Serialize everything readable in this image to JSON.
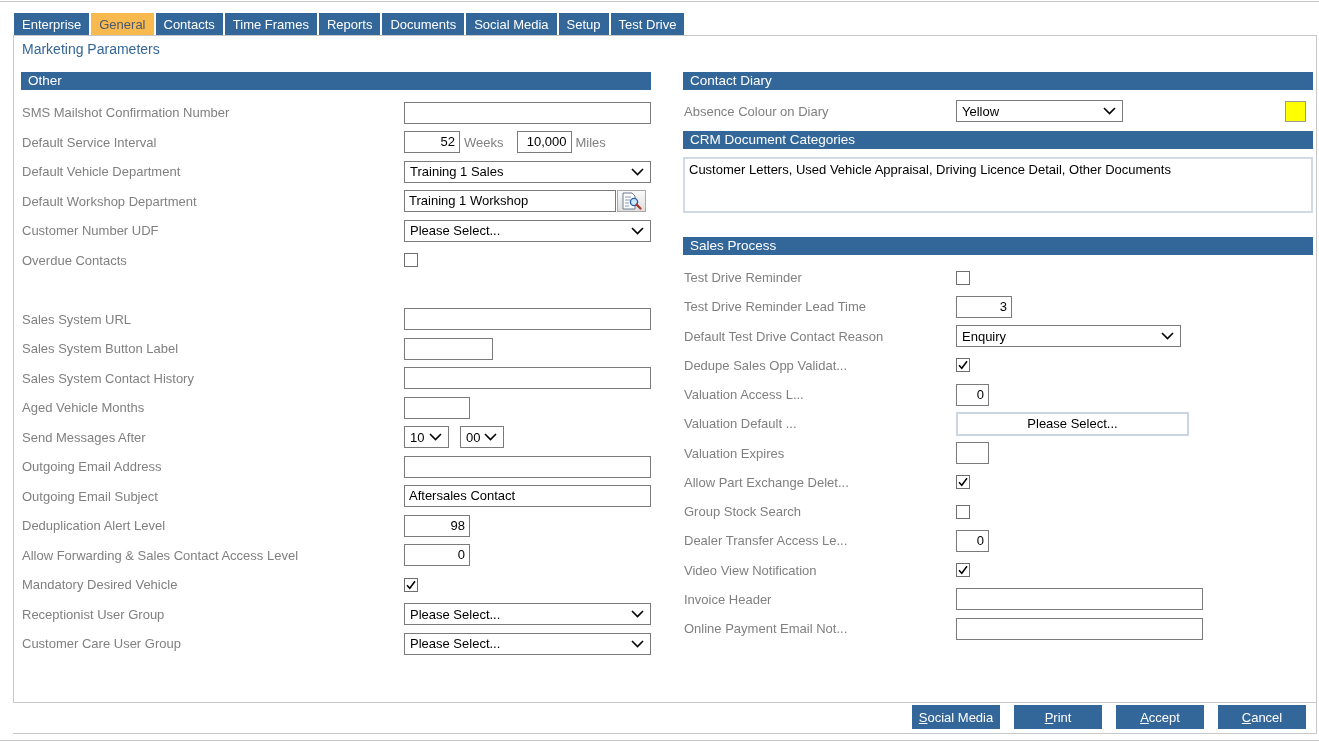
{
  "tabs": [
    {
      "label": "Enterprise",
      "selected": false
    },
    {
      "label": "General",
      "selected": true
    },
    {
      "label": "Contacts",
      "selected": false
    },
    {
      "label": "Time Frames",
      "selected": false
    },
    {
      "label": "Reports",
      "selected": false
    },
    {
      "label": "Documents",
      "selected": false
    },
    {
      "label": "Social Media",
      "selected": false
    },
    {
      "label": "Setup",
      "selected": false
    },
    {
      "label": "Test Drive",
      "selected": false
    }
  ],
  "page_title": "Marketing Parameters",
  "other": {
    "title": "Other",
    "field_groups": [
      [
        {
          "kind": "text",
          "label": "SMS Mailshot Confirmation Number"
        },
        {
          "kind": "interval",
          "label": "Default Service Interval",
          "parts": [
            {
              "value": "52",
              "unit": "Weeks"
            },
            {
              "value": "10,000",
              "unit": "Miles"
            }
          ]
        },
        {
          "kind": "select",
          "label": "Default Vehicle Department",
          "value": "Training 1 Sales"
        },
        {
          "kind": "lookup",
          "label": "Default Workshop Department",
          "value": "Training 1 Workshop"
        },
        {
          "kind": "select",
          "label": "Customer Number UDF",
          "value": "Please Select..."
        },
        {
          "kind": "checkbox",
          "label": "Overdue Contacts",
          "checked": false
        }
      ],
      [
        {
          "kind": "text",
          "label": "Sales System URL"
        },
        {
          "kind": "text",
          "label": "Sales System Button Label"
        },
        {
          "kind": "text",
          "label": "Sales System Contact History"
        },
        {
          "kind": "text",
          "label": "Aged Vehicle Months"
        },
        {
          "kind": "time",
          "label": "Send Messages After",
          "values": [
            "10",
            "00"
          ]
        },
        {
          "kind": "text",
          "label": "Outgoing Email Address"
        },
        {
          "kind": "text",
          "label": "Outgoing Email Subject",
          "value": "Aftersales Contact"
        },
        {
          "kind": "number",
          "label": "Deduplication Alert Level",
          "value": "98"
        },
        {
          "kind": "number",
          "label": "Allow Forwarding & Sales Contact Access Level",
          "value": "0"
        },
        {
          "kind": "checkbox",
          "label": "Mandatory Desired Vehicle",
          "checked": true
        },
        {
          "kind": "select",
          "label": "Receptionist User Group",
          "value": "Please Select..."
        },
        {
          "kind": "select",
          "label": "Customer Care User Group",
          "value": "Please Select..."
        }
      ]
    ]
  },
  "contact_diary": {
    "title": "Contact Diary",
    "fields": [
      {
        "kind": "select",
        "label": "Absence Colour on Diary",
        "value": "Yellow",
        "color": "#ffff00"
      }
    ]
  },
  "crm_document_categories": {
    "title": "CRM Document Categories",
    "value": "Customer Letters, Used Vehicle Appraisal, Driving Licence Detail, Other Documents"
  },
  "sales_process": {
    "title": "Sales Process",
    "fields": [
      {
        "kind": "checkbox",
        "label": "Test Drive Reminder",
        "checked": false
      },
      {
        "kind": "number",
        "label": "Test Drive Reminder Lead Time",
        "value": "3"
      },
      {
        "kind": "select",
        "label": "Default Test Drive Contact Reason",
        "value": "Enquiry"
      },
      {
        "kind": "checkbox",
        "label": "Dedupe Sales Opp Validat...",
        "checked": true
      },
      {
        "kind": "number",
        "label": "Valuation Access L...",
        "value": "0"
      },
      {
        "kind": "picker",
        "label": "Valuation Default ...",
        "value": "Please Select..."
      },
      {
        "kind": "number",
        "label": "Valuation Expires"
      },
      {
        "kind": "checkbox",
        "label": "Allow Part Exchange Delet...",
        "checked": true
      },
      {
        "kind": "checkbox",
        "label": "Group Stock Search",
        "checked": false
      },
      {
        "kind": "number",
        "label": "Dealer Transfer Access Le...",
        "value": "0"
      },
      {
        "kind": "checkbox",
        "label": "Video View Notification",
        "checked": true
      },
      {
        "kind": "text",
        "label": "Invoice Header"
      },
      {
        "kind": "text",
        "label": "Online Payment Email Not..."
      }
    ]
  },
  "footer_buttons": [
    "Social Media",
    "Print",
    "Accept",
    "Cancel"
  ]
}
